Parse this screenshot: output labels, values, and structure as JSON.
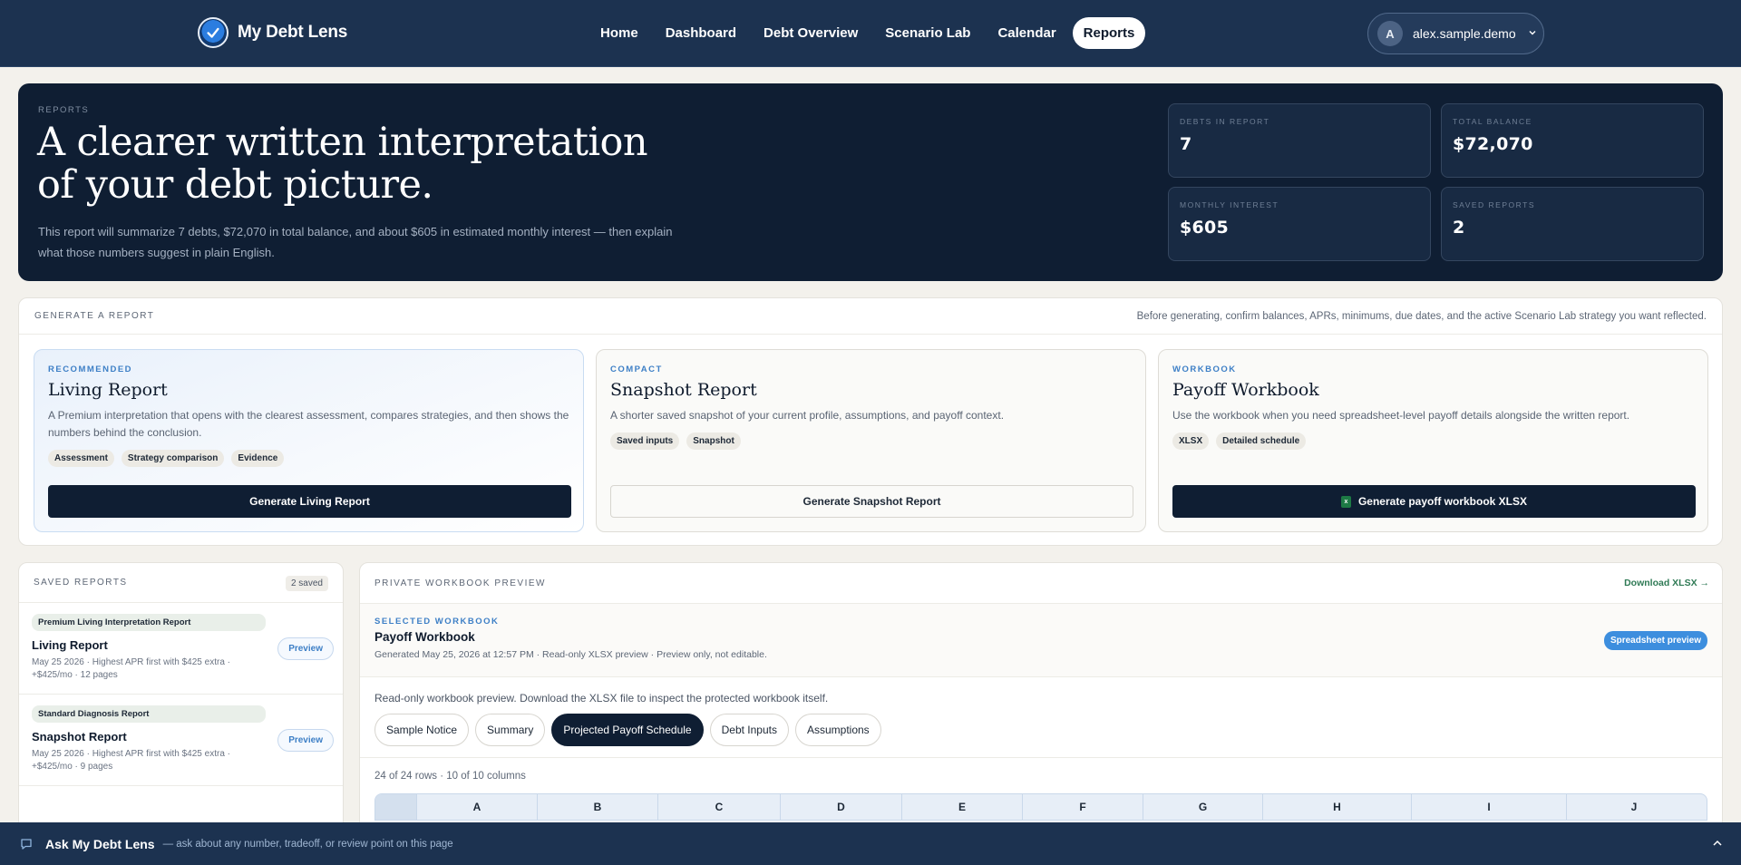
{
  "nav": {
    "brand": "My Debt Lens",
    "links": [
      "Home",
      "Dashboard",
      "Debt Overview",
      "Scenario Lab",
      "Calendar",
      "Reports"
    ],
    "active": "Reports",
    "user": {
      "initial": "A",
      "name": "alex.sample.demo"
    }
  },
  "hero": {
    "eyebrow": "REPORTS",
    "title": "A clearer written interpretation of your debt picture.",
    "subtitle": "This report will summarize 7 debts, $72,070 in total balance, and about $605 in estimated monthly interest — then explain what those numbers suggest in plain English.",
    "stats": [
      {
        "label": "DEBTS IN REPORT",
        "value": "7"
      },
      {
        "label": "TOTAL BALANCE",
        "value": "$72,070"
      },
      {
        "label": "MONTHLY INTEREST",
        "value": "$605"
      },
      {
        "label": "SAVED REPORTS",
        "value": "2"
      }
    ]
  },
  "generate": {
    "eyebrow": "GENERATE A REPORT",
    "note": "Before generating, confirm balances, APRs, minimums, due dates, and the active Scenario Lab strategy you want reflected.",
    "cards": [
      {
        "eyebrow": "RECOMMENDED",
        "title": "Living Report",
        "desc": "A Premium interpretation that opens with the clearest assessment, compares strategies, and then shows the numbers behind the conclusion.",
        "chips": [
          "Assessment",
          "Strategy comparison",
          "Evidence"
        ],
        "button": "Generate Living Report"
      },
      {
        "eyebrow": "COMPACT",
        "title": "Snapshot Report",
        "desc": "A shorter saved snapshot of your current profile, assumptions, and payoff context.",
        "chips": [
          "Saved inputs",
          "Snapshot"
        ],
        "button": "Generate Snapshot Report"
      },
      {
        "eyebrow": "WORKBOOK",
        "title": "Payoff Workbook",
        "desc": "Use the workbook when you need spreadsheet-level payoff details alongside the written report.",
        "chips": [
          "XLSX",
          "Detailed schedule"
        ],
        "button": "Generate payoff workbook XLSX"
      }
    ]
  },
  "saved": {
    "eyebrow": "SAVED REPORTS",
    "count": "2 saved",
    "items": [
      {
        "tag": "Premium Living Interpretation Report",
        "title": "Living Report",
        "meta": "May 25 2026 · Highest APR first with $425 extra · +$425/mo · 12 pages",
        "action": "Preview"
      },
      {
        "tag": "Standard Diagnosis Report",
        "title": "Snapshot Report",
        "meta": "May 25 2026 · Highest APR first with $425 extra · +$425/mo · 9 pages",
        "action": "Preview"
      }
    ]
  },
  "workbook": {
    "eyebrow": "PRIVATE WORKBOOK PREVIEW",
    "download": "Download XLSX →",
    "selected_eyebrow": "SELECTED WORKBOOK",
    "title": "Payoff Workbook",
    "meta": "Generated May 25, 2026 at 12:57 PM · Read-only XLSX preview · Preview only, not editable.",
    "badge": "Spreadsheet preview",
    "note": "Read-only workbook preview. Download the XLSX file to inspect the protected workbook itself.",
    "tabs": [
      "Sample Notice",
      "Summary",
      "Projected Payoff Schedule",
      "Debt Inputs",
      "Assumptions"
    ],
    "active_tab": "Projected Payoff Schedule",
    "rows_info": "24 of 24 rows · 10 of 10 columns",
    "columns": [
      "A",
      "B",
      "C",
      "D",
      "E",
      "F",
      "G",
      "H",
      "I",
      "J"
    ]
  },
  "ask": {
    "title": "Ask My Debt Lens",
    "hint": "— ask about any number, tradeoff, or review point on this page"
  },
  "colors": {
    "nav": "#1c3250",
    "hero": "#0f1e33",
    "accent_blue": "#3d7fc6",
    "download_green": "#2f7a55"
  }
}
